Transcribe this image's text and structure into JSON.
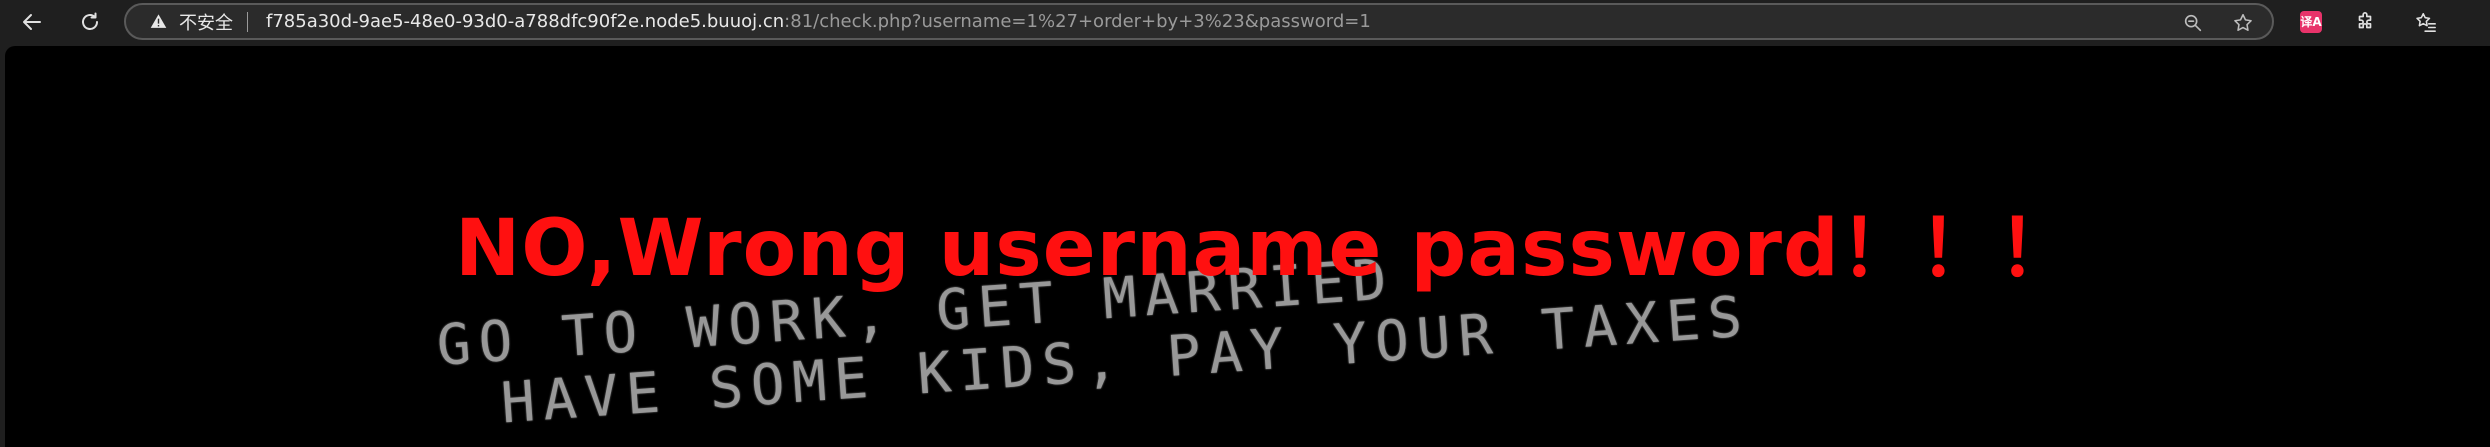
{
  "browser": {
    "security_label": "不安全",
    "url_host": "f785a30d-9ae5-48e0-93d0-a788dfc90f2e.node5.buuoj.cn",
    "url_rest": ":81/check.php?username=1%27+order+by+3%23&password=1",
    "icons": [
      "back-arrow-icon",
      "reload-icon",
      "warning-icon",
      "zoom-icon",
      "star-icon",
      "translate-extension-icon",
      "puzzle-icon",
      "favorites-icon"
    ],
    "translate_badge": "译A"
  },
  "page": {
    "error_message": "NO,Wrong username password！！！",
    "background_text": {
      "line1": "GO TO WORK, GET MARRIED",
      "line2": "HAVE SOME KIDS, PAY YOUR TAXES"
    },
    "colors": {
      "message": "#ff1010",
      "page_background": "#000000"
    }
  }
}
